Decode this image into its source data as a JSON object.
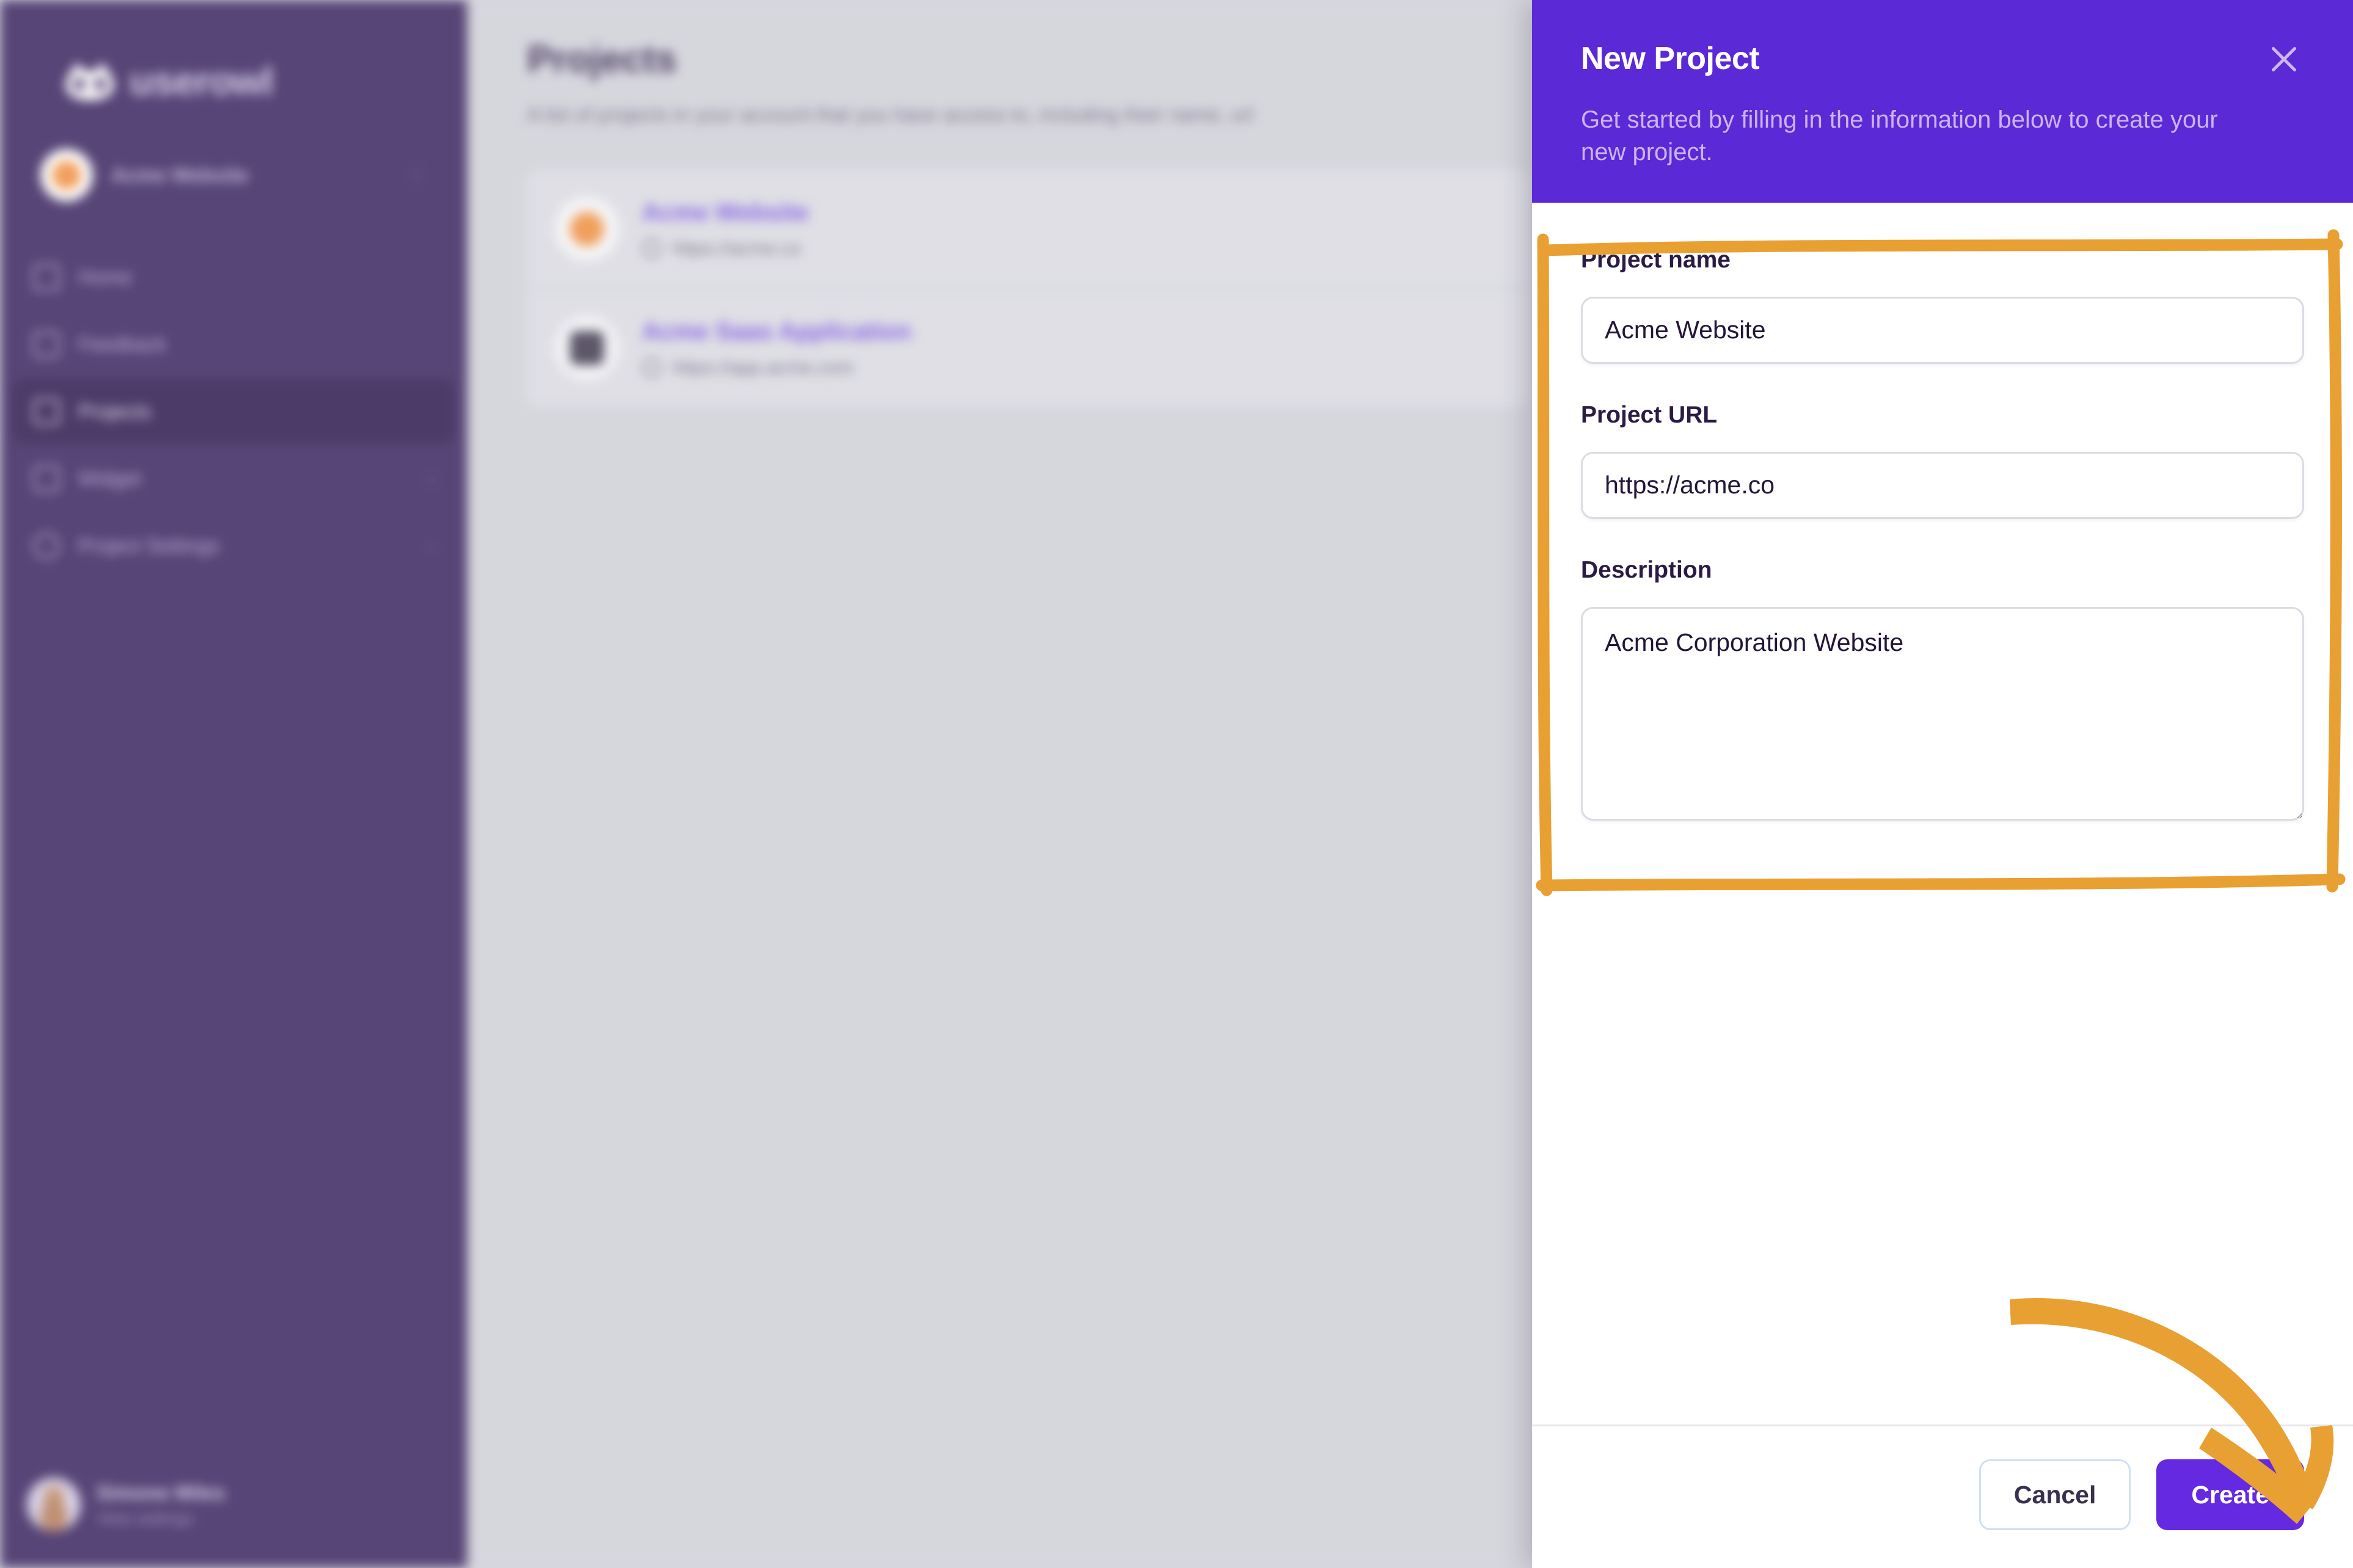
{
  "brand": {
    "name": "userowl",
    "logo_icon": "owl-icon"
  },
  "sidebar": {
    "workspace": {
      "name": "Acme Website",
      "menu_icon": "kebab-menu-icon"
    },
    "items": [
      {
        "label": "Home",
        "icon": "home-icon",
        "active": false,
        "chevron": ""
      },
      {
        "label": "Feedback",
        "icon": "feedback-icon",
        "active": false,
        "chevron": ""
      },
      {
        "label": "Projects",
        "icon": "projects-icon",
        "active": true,
        "chevron": ""
      },
      {
        "label": "Widget",
        "icon": "widget-icon",
        "active": false,
        "chevron": "›"
      },
      {
        "label": "Project Settings",
        "icon": "settings-icon",
        "active": false,
        "chevron": "›"
      }
    ],
    "profile": {
      "name": "Simone Miles",
      "subtitle": "View settings",
      "avatar_icon": "user-avatar"
    }
  },
  "main": {
    "title": "Projects",
    "subtitle": "A list of projects in your account that you have access to, including their name, url",
    "projects": [
      {
        "name": "Acme Website",
        "url": "https://acme.co",
        "url_icon": "globe-icon",
        "logo_icon": "acme-logo"
      },
      {
        "name": "Acme Saas Application",
        "url": "https://app.acme.com",
        "url_icon": "globe-icon",
        "logo_icon": "acme-saas-logo"
      }
    ]
  },
  "drawer": {
    "title": "New Project",
    "description": "Get started by filling in the information below to create your new project.",
    "close_icon": "close-icon",
    "fields": {
      "project_name": {
        "label": "Project name",
        "value": "Acme Website",
        "placeholder": "Project name"
      },
      "project_url": {
        "label": "Project URL",
        "value": "https://acme.co",
        "placeholder": "https://"
      },
      "description": {
        "label": "Description",
        "value": "Acme Corporation Website",
        "placeholder": "Description"
      }
    },
    "footer": {
      "cancel_label": "Cancel",
      "create_label": "Create"
    }
  },
  "annotations": {
    "highlight_box": {
      "shape": "hand-drawn-rectangle",
      "color": "#E8A033",
      "target": "form-fields"
    },
    "arrow": {
      "shape": "hand-drawn-curved-arrow",
      "color": "#E8A033",
      "target": "create-button"
    }
  },
  "colors": {
    "sidebar_bg": "#453068",
    "sidebar_active": "#382457",
    "drawer_header": "#5B29D6",
    "primary_button": "#6429E0",
    "accent_orange": "#E8A033",
    "page_bg": "#D2D2DA",
    "link_purple": "#7B56E0"
  }
}
